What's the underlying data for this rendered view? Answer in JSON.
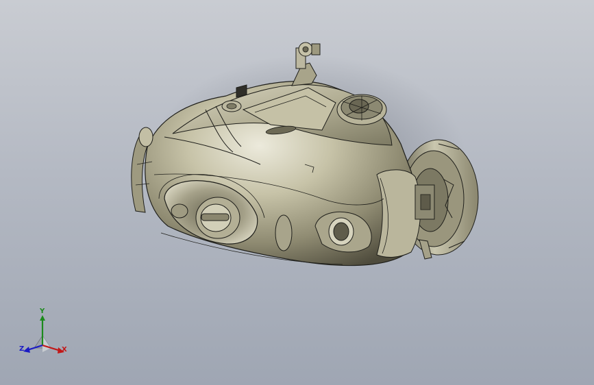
{
  "app": {
    "kind": "cad-3d-viewport"
  },
  "viewport": {
    "background_top": "#c9ccd2",
    "background_bottom": "#9fa6b3",
    "model_color": "#a9a58c",
    "edge_color": "#1e1e1a"
  },
  "triad": {
    "y_label": "Y",
    "x_label": "X",
    "z_label": "Z",
    "y_color": "#1c8a1c",
    "x_color": "#c21818",
    "z_color": "#1b1bc4"
  }
}
